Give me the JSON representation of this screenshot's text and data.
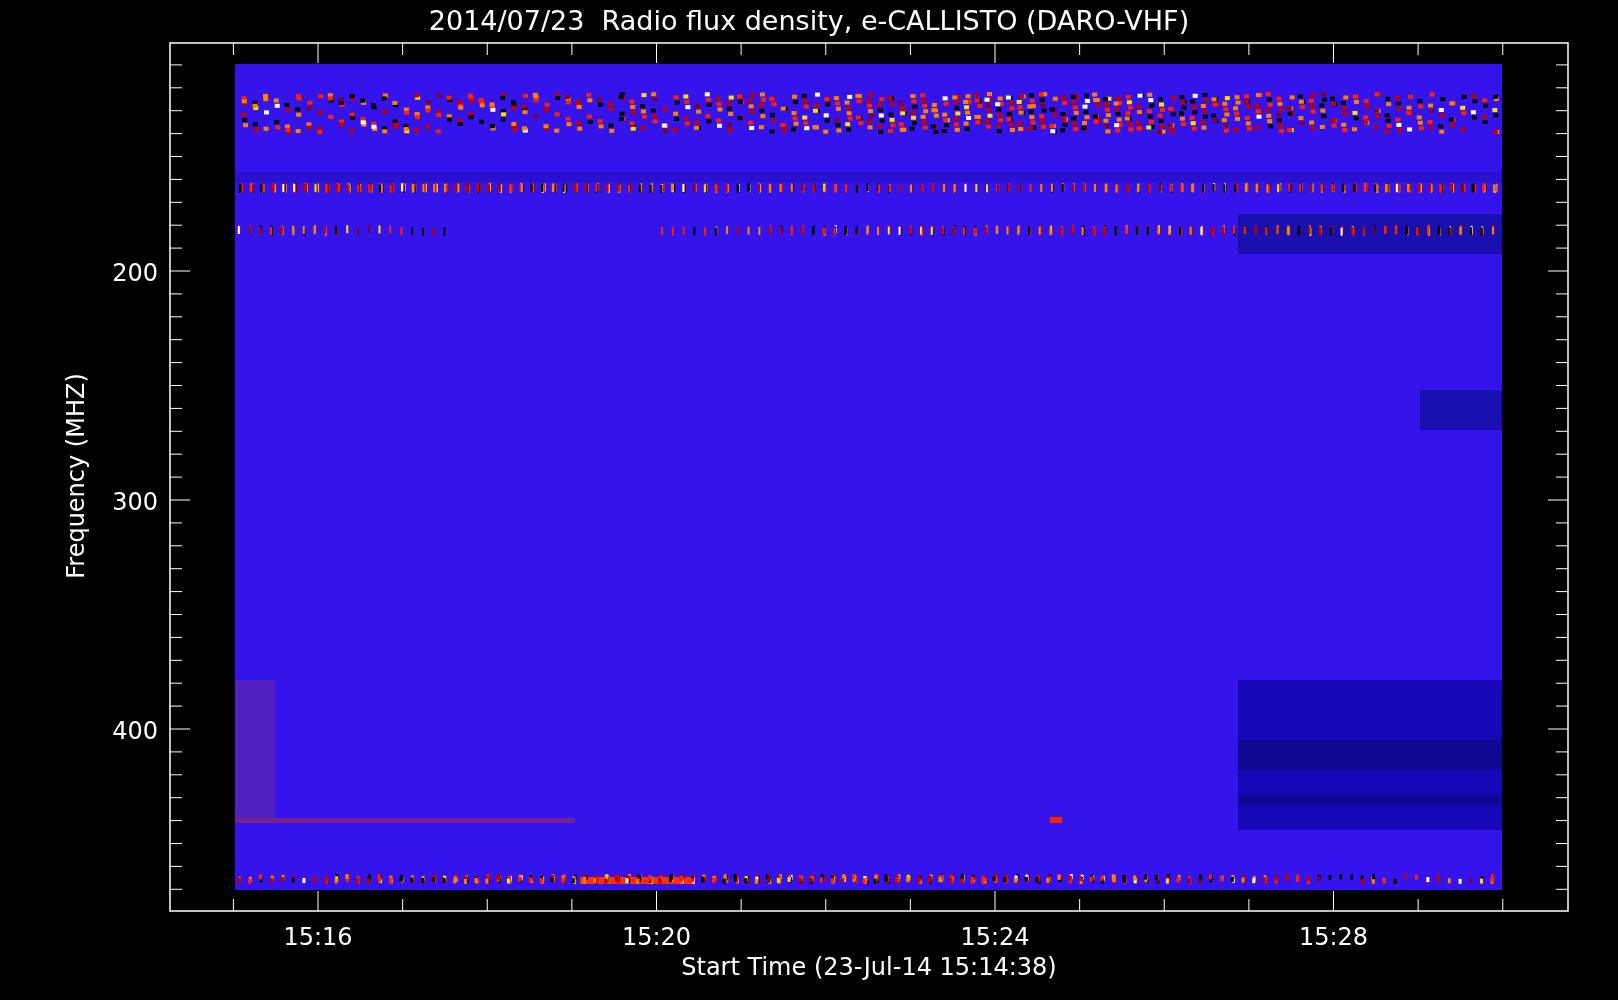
{
  "chart": {
    "title": "2014/07/23  Radio flux density, e-CALLISTO (DARO-VHF)",
    "ylabel": "Frequency (MHZ)",
    "xlabel": "Start Time (23-Jul-14 15:14:38)",
    "yticks": [
      "200",
      "300",
      "400"
    ],
    "xticks": [
      "15:16",
      "15:20",
      "15:24",
      "15:28"
    ]
  }
}
